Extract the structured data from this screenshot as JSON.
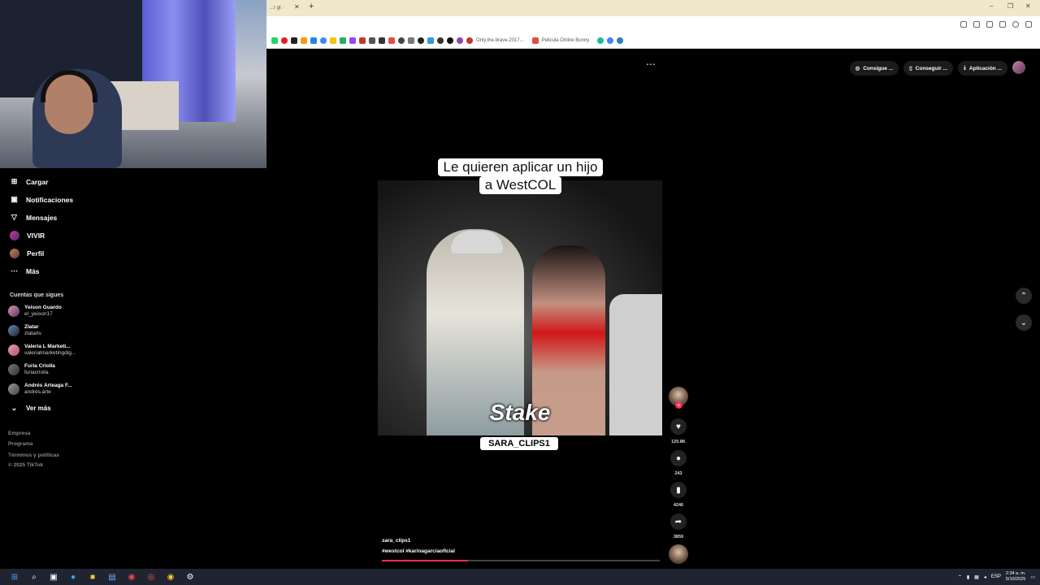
{
  "browser": {
    "tab_title": "...r gt ·",
    "new_tab_symbol": "+",
    "bookmarks": [
      {
        "text": "Only.the.brave.2017..."
      },
      {
        "text": "Pelicula Online Bunny"
      }
    ]
  },
  "sidebar": {
    "nav": [
      {
        "label": "Cargar",
        "icon": "upload-icon"
      },
      {
        "label": "Notificaciones",
        "icon": "inbox-icon"
      },
      {
        "label": "Mensajes",
        "icon": "send-icon"
      },
      {
        "label": "VIVIR",
        "icon": "live-avatar-icon"
      },
      {
        "label": "Perfil",
        "icon": "profile-avatar-icon"
      },
      {
        "label": "Más",
        "icon": "more-icon"
      }
    ],
    "following_title": "Cuentas que sigues",
    "accounts": [
      {
        "name": "Yeison Guardo",
        "user": "el_yeison17"
      },
      {
        "name": "Zlatar",
        "user": "zlatartv"
      },
      {
        "name": "Valeria L Marketi...",
        "user": "valerialmarketingdig..."
      },
      {
        "name": "Furia Criolla",
        "user": "furiacriolla"
      },
      {
        "name": "Andrés Arteaga F...",
        "user": "andrés.arte"
      }
    ],
    "see_more": "Ver más",
    "footer": [
      "Empresa",
      "Programa",
      "Términos y políticas",
      "© 2025 TikTok"
    ]
  },
  "topbar": {
    "buttons": [
      "Consigue ...",
      "Conseguir ...",
      "Aplicación ..."
    ]
  },
  "video": {
    "caption_line1": "Le quieren aplicar un hijo",
    "caption_line2": "a WestCOL",
    "overlay_brand": "Stake",
    "watermark": "SARA_CLIPS1",
    "author": "sara_clips1",
    "hashtags": "#westcol  #karinagarciaoficial",
    "progress": 0.31
  },
  "actions": {
    "likes": "120.8K",
    "comments": "243",
    "saves": "4246",
    "shares": "3859"
  },
  "taskbar": {
    "lang": "ESP",
    "time": "2:34 a. m.",
    "date": "5/10/2025"
  },
  "colors": {
    "accent": "#fe2c55",
    "background": "#000000",
    "taskbar": "#1f2430"
  }
}
